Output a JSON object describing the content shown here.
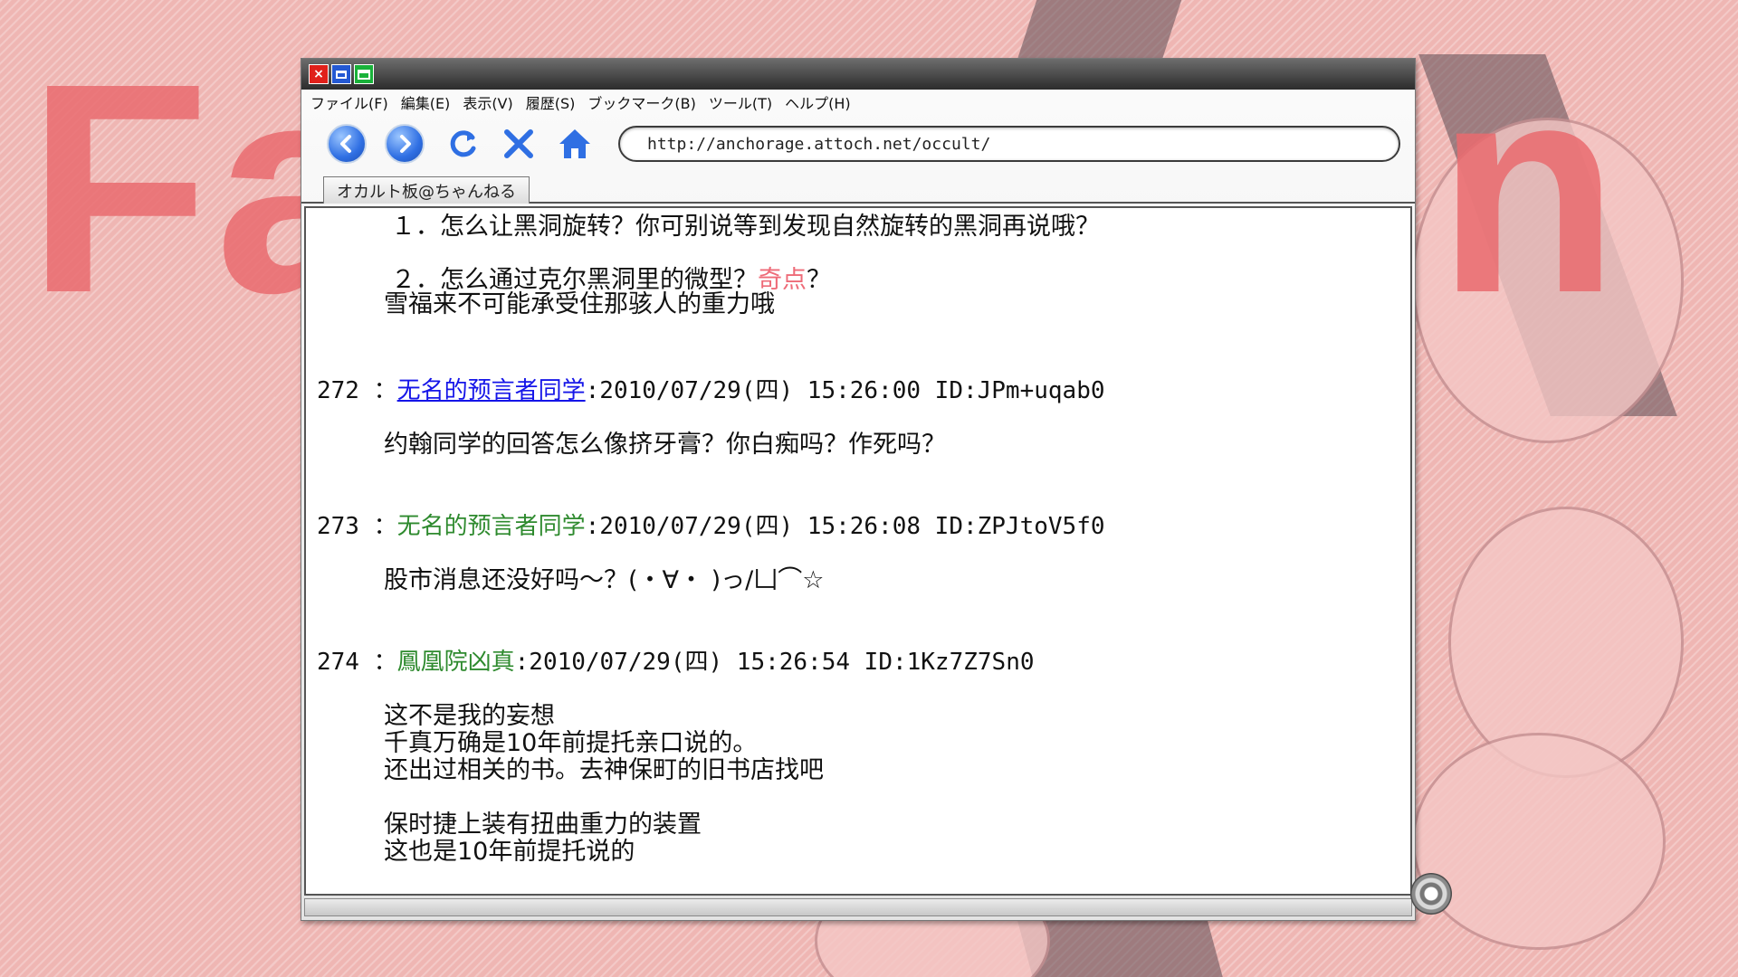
{
  "background": {
    "title_text": "Fa",
    "title_text_2": "n"
  },
  "window": {
    "controls": {
      "close": "×"
    },
    "menu": [
      "ファイル(F)",
      "編集(E)",
      "表示(V)",
      "履歴(S)",
      "ブックマーク(B)",
      "ツール(T)",
      "ヘルプ(H)"
    ],
    "toolbar_icons": [
      "back-icon",
      "forward-icon",
      "reload-icon",
      "stop-icon",
      "home-icon"
    ],
    "address": "http://anchorage.attoch.net/occult/",
    "tab_label": "オカルト板@ちゃんねる",
    "colors": {
      "titlebar": "#3a3a3a",
      "link": "#1515e8",
      "name_green": "#2e8a2e",
      "highlight": "#ee6b78"
    }
  },
  "thread": {
    "prev_post": {
      "line1": "１．怎么让黑洞旋转？你可别说等到发现自然旋转的黑洞再说哦？",
      "line2_pre": "２．怎么通过克尔黑洞里的微型？",
      "line2_hl": "奇点",
      "line2_post": "？",
      "line3": "雪福来不可能承受住那骇人的重力哦"
    },
    "posts": [
      {
        "number": "272 ：",
        "name": "无名的预言者同学",
        "meta": ":2010/07/29(四) 15:26:00 ID:JPm+uqab0",
        "lines": [
          "约翰同学的回答怎么像挤牙膏？你白痴吗？作死吗？"
        ]
      },
      {
        "number": "273 ：",
        "name": "无名的预言者同学",
        "meta": ":2010/07/29(四) 15:26:08 ID:ZPJtoV5f0",
        "lines": [
          "股市消息还没好吗～？(・∀・ )っ/凵⌒☆"
        ]
      },
      {
        "number": "274 ：",
        "name": "鳳凰院凶真",
        "meta": ":2010/07/29(四) 15:26:54 ID:1Kz7Z7Sn0",
        "lines": [
          "这不是我的妄想",
          "千真万确是10年前提托亲口说的。",
          "还出过相关的书。去神保町的旧书店找吧",
          "保时捷上装有扭曲重力的装置",
          "这也是10年前提托说的"
        ]
      }
    ]
  }
}
